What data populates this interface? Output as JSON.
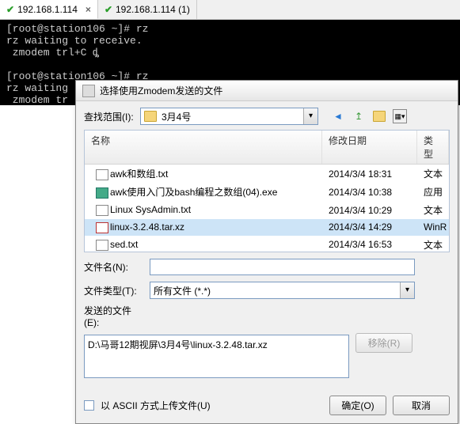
{
  "tabs": [
    {
      "label": "192.168.1.114",
      "active": true
    },
    {
      "label": "192.168.1.114 (1)",
      "active": false
    }
  ],
  "terminal": {
    "l1": "[root@station106 ~]# rz",
    "l2": "rz waiting to receive.",
    "l3": " zmodem trl+C ȡ",
    "l4": "",
    "l5": "[root@station106 ~]# rz",
    "l6": "rz waiting to receive.",
    "l7": " zmodem tr"
  },
  "dialog": {
    "title": "选择使用Zmodem发送的文件",
    "lookin_label": "查找范围(I):",
    "folder_name": "3月4号",
    "columns": {
      "name": "名称",
      "date": "修改日期",
      "type": "类型"
    },
    "files": [
      {
        "name": "awk和数组.txt",
        "date": "2014/3/4 18:31",
        "type": "文本",
        "ico": "ico-txt"
      },
      {
        "name": "awk使用入门及bash编程之数组(04).exe",
        "date": "2014/3/4 10:38",
        "type": "应用",
        "ico": "ico-exe"
      },
      {
        "name": "Linux SysAdmin.txt",
        "date": "2014/3/4 10:29",
        "type": "文本",
        "ico": "ico-txt"
      },
      {
        "name": "linux-3.2.48.tar.xz",
        "date": "2014/3/4 14:29",
        "type": "WinR",
        "ico": "ico-xz",
        "selected": true
      },
      {
        "name": "sed.txt",
        "date": "2014/3/4 16:53",
        "type": "文本",
        "ico": "ico-txt"
      }
    ],
    "filename_label": "文件名(N):",
    "filetype_label": "文件类型(T):",
    "filetype_value": "所有文件 (*.*)",
    "sent_label": "发送的文件(E):",
    "sent_path": "D:\\马哥12期视屏\\3月4号\\linux-3.2.48.tar.xz",
    "remove_btn": "移除(R)",
    "ascii_label": "以 ASCII 方式上传文件(U)",
    "ok_btn": "确定(O)",
    "cancel_btn": "取消"
  }
}
